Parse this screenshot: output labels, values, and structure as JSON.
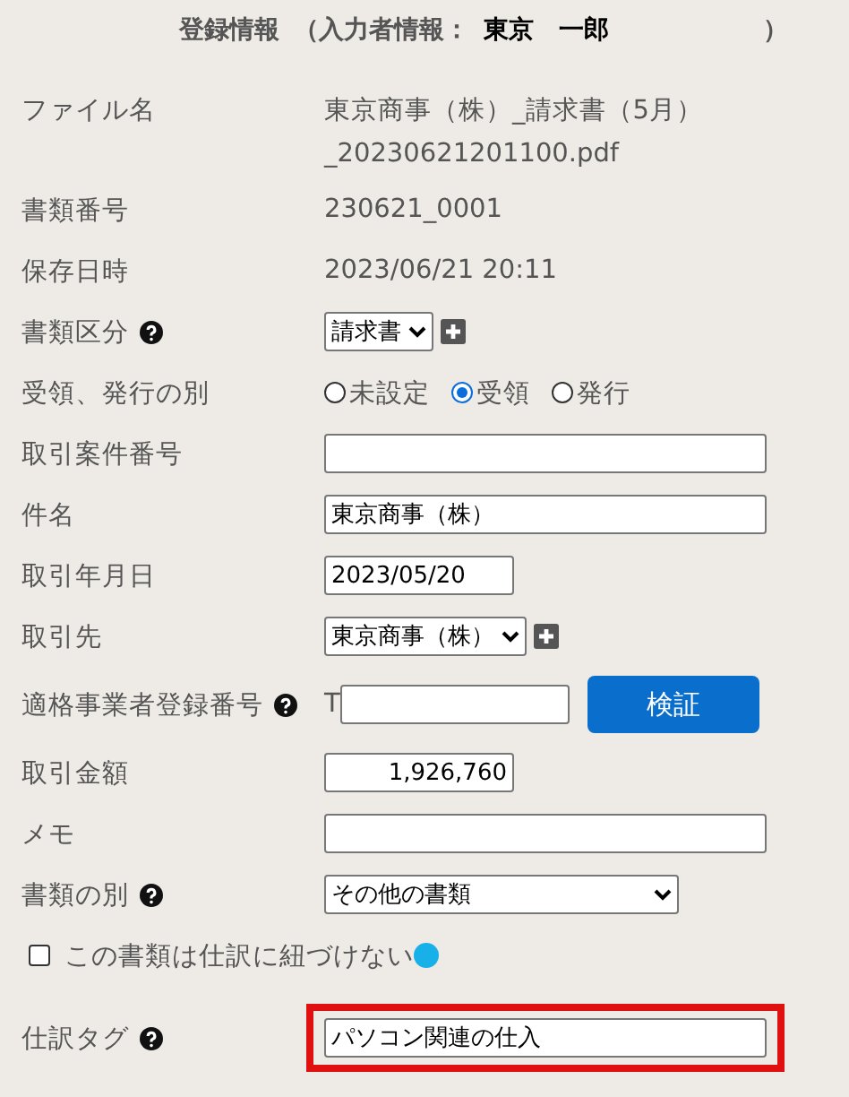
{
  "header": {
    "title": "登録情報",
    "prefix": "（入力者情報：",
    "user": "東京　一郎",
    "suffix": "）"
  },
  "rows": [
    {
      "kind": "text",
      "label": "ファイル名",
      "help": false,
      "value": "東京商事（株）_請求書（5月）_20230621201100.pdf"
    },
    {
      "kind": "text",
      "label": "書類番号",
      "help": false,
      "value": "230621_0001"
    },
    {
      "kind": "text",
      "label": "保存日時",
      "help": false,
      "value": "2023/06/21 20:11"
    },
    {
      "kind": "select",
      "label": "書類区分",
      "help": true,
      "value": "請求書",
      "add_button": true
    },
    {
      "kind": "radio",
      "label": "受領、発行の別",
      "help": false,
      "options": [
        {
          "label": "未設定",
          "selected": false
        },
        {
          "label": "受領",
          "selected": true
        },
        {
          "label": "発行",
          "selected": false
        }
      ]
    },
    {
      "kind": "input",
      "label": "取引案件番号",
      "help": false
    },
    {
      "kind": "input",
      "label": "件名",
      "help": false,
      "value": "東京商事（株）"
    },
    {
      "kind": "date",
      "label": "取引年月日",
      "help": false,
      "value": "2023/05/20"
    },
    {
      "kind": "select",
      "label": "取引先",
      "help": false,
      "value": "東京商事（株）",
      "add_button": true
    },
    {
      "kind": "registration",
      "label": "適格事業者登録番号",
      "help": true,
      "prefix": "T",
      "button": "検証"
    },
    {
      "kind": "amount",
      "label": "取引金額",
      "help": false,
      "value": "1,926,760"
    },
    {
      "kind": "input",
      "label": "メモ",
      "help": false
    },
    {
      "kind": "long_select",
      "label": "書類の別",
      "help": true,
      "value": "その他の書類",
      "add_button": false
    },
    {
      "kind": "checkbox",
      "label": "この書類は仕訳に紐づけない",
      "checked": false,
      "info_dot": true
    },
    {
      "kind": "input",
      "label": "仕訳タグ",
      "help": true,
      "value": "パソコン関連の仕入",
      "highlighted": true
    }
  ]
}
